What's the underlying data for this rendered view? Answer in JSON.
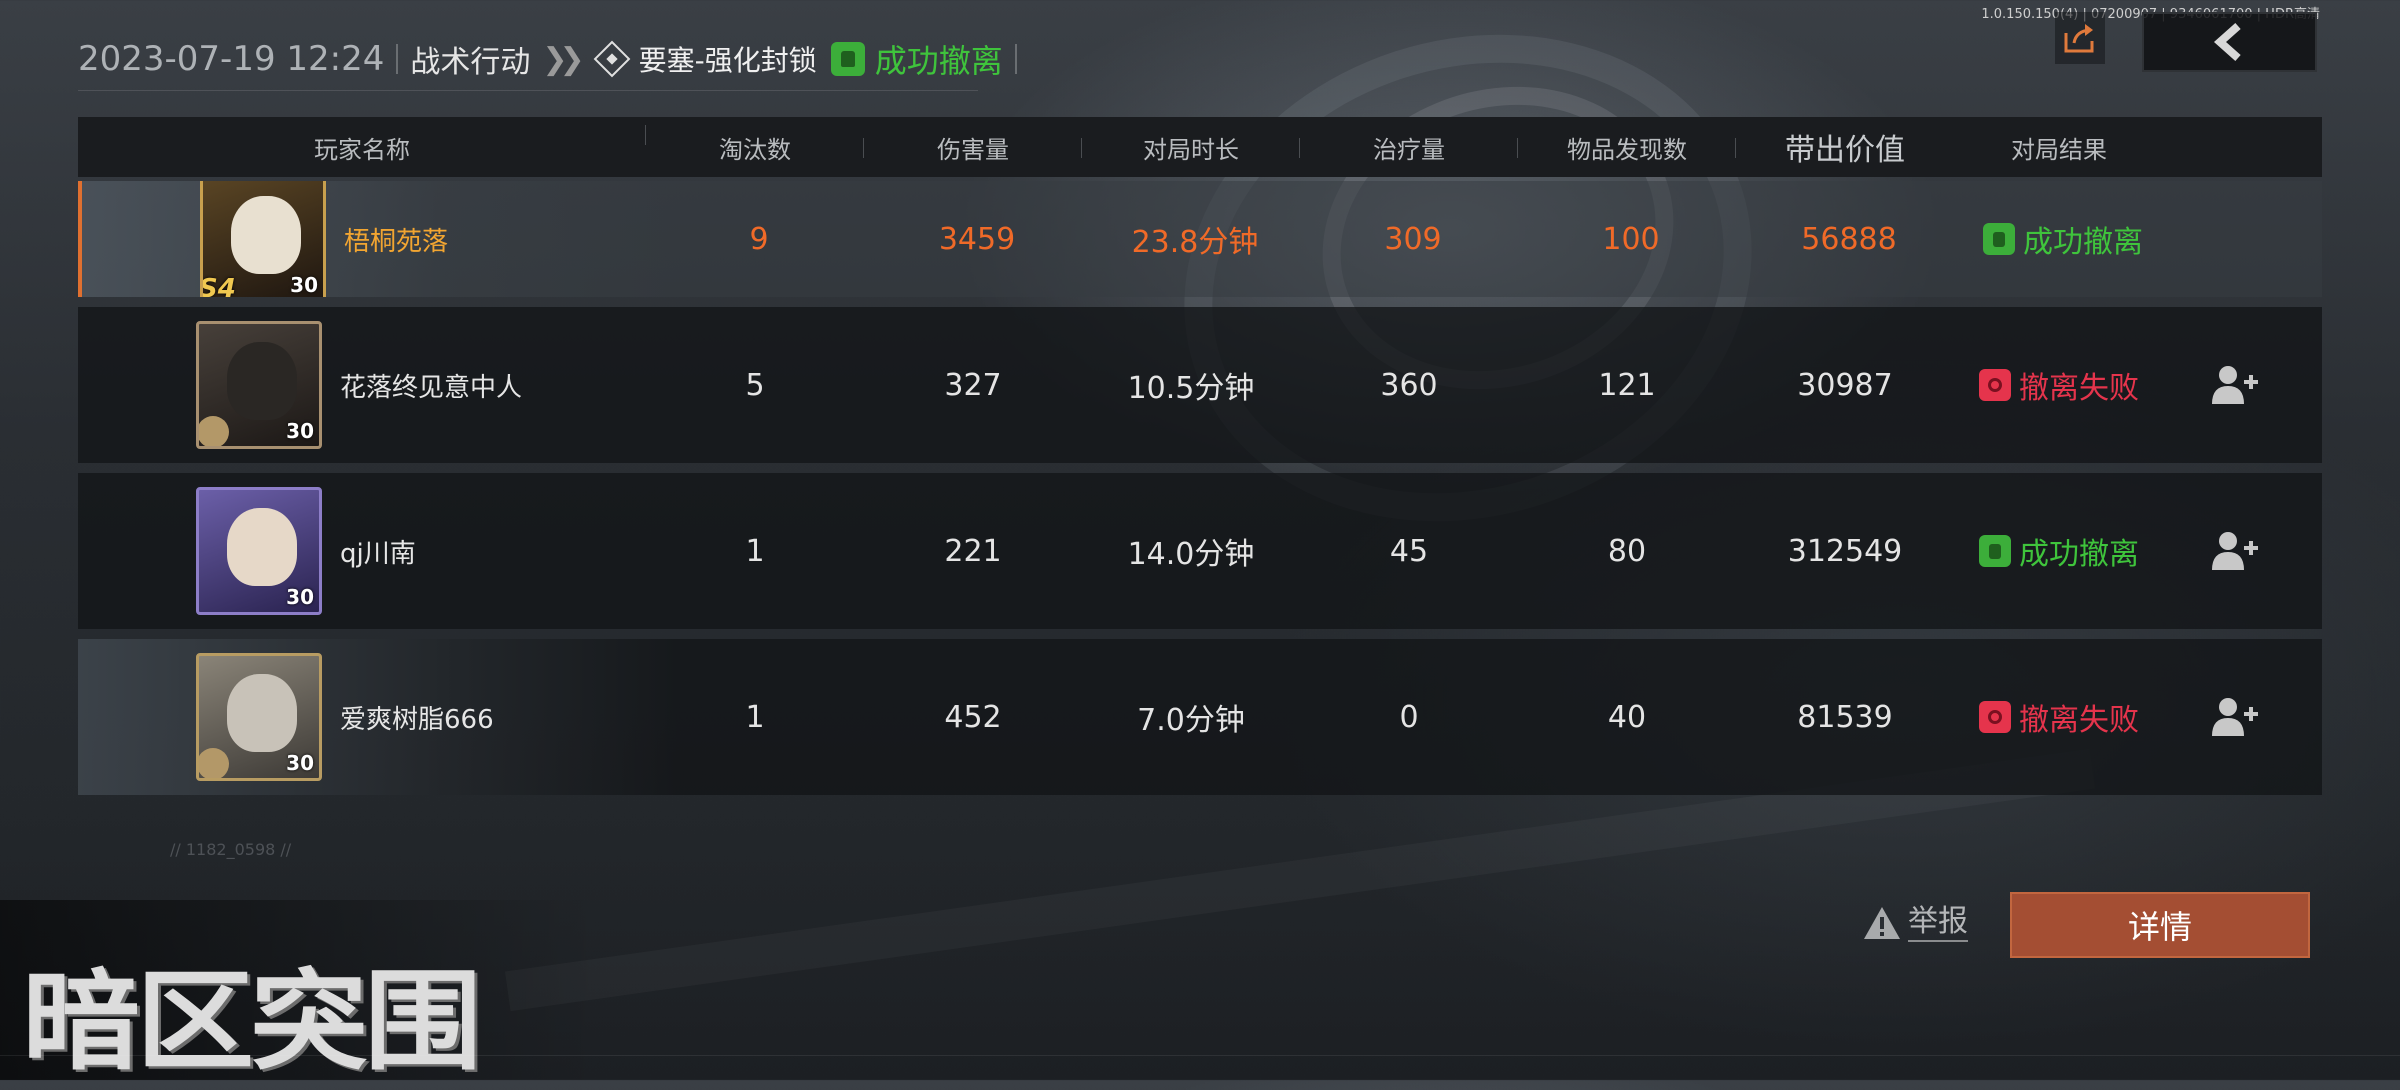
{
  "build_info": "1.0.150.150(4) | 07200907 | 9346061700 | HDR高清",
  "header": {
    "datetime": "2023-07-19 12:24",
    "mode": "战术行动",
    "map": "要塞-强化封锁",
    "result": "成功撤离"
  },
  "columns": [
    "玩家名称",
    "淘汰数",
    "伤害量",
    "对局时长",
    "治疗量",
    "物品发现数",
    "带出价值",
    "对局结果"
  ],
  "players": [
    {
      "name": "梧桐苑落",
      "level": "30",
      "season": "S4",
      "kills": "9",
      "damage": "3459",
      "duration": "23.8分钟",
      "heal": "309",
      "items": "100",
      "value": "56888",
      "result": "成功撤离",
      "result_type": "ok",
      "self": true
    },
    {
      "name": "花落终见意中人",
      "level": "30",
      "kills": "5",
      "damage": "327",
      "duration": "10.5分钟",
      "heal": "360",
      "items": "121",
      "value": "30987",
      "result": "撤离失败",
      "result_type": "fail"
    },
    {
      "name": "qj川南",
      "level": "30",
      "kills": "1",
      "damage": "221",
      "duration": "14.0分钟",
      "heal": "45",
      "items": "80",
      "value": "312549",
      "result": "成功撤离",
      "result_type": "ok"
    },
    {
      "name": "爱爽树脂666",
      "level": "30",
      "kills": "1",
      "damage": "452",
      "duration": "7.0分钟",
      "heal": "0",
      "items": "40",
      "value": "81539",
      "result": "撤离失败",
      "result_type": "fail"
    }
  ],
  "footnote": "// 1182_0598 //",
  "buttons": {
    "report": "举报",
    "details": "详情"
  },
  "logo": "暗区突围",
  "colors": {
    "success": "#3fc43c",
    "fail": "#e5344c",
    "self_highlight": "#f06a28",
    "accent_button": "#a44e33"
  },
  "icons": [
    "share-icon",
    "back-arrow-icon",
    "map-diamond-icon",
    "extract-success-icon",
    "extract-fail-icon",
    "add-friend-icon",
    "warning-icon"
  ]
}
